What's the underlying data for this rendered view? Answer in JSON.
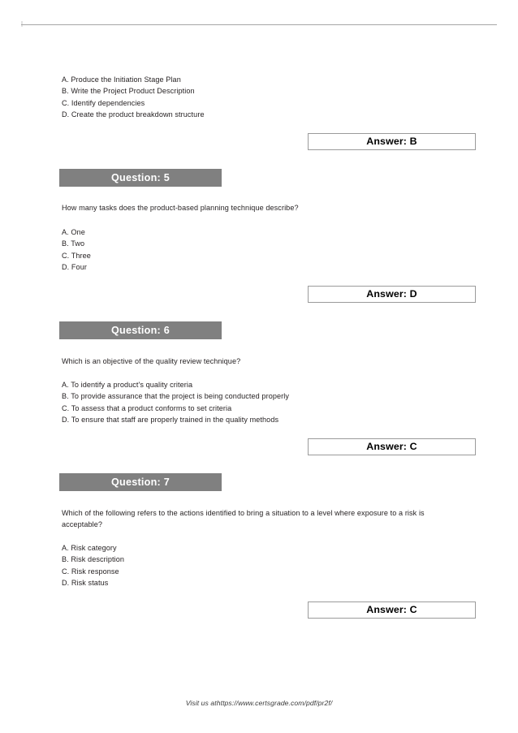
{
  "document": {
    "footer_text": "Visit us athttps://www.certsgrade.com/pdf/pr2f/",
    "accent_gray": "#808080",
    "rule_color": "#a6a6a6",
    "answer_border_color": "#9b9b9b"
  },
  "leading_options": {
    "a": "A. Produce the Initiation Stage Plan",
    "b": "B. Write the Project Product Description",
    "c": "C. Identify dependencies",
    "d": "D. Create the product breakdown structure"
  },
  "leading_answer": {
    "label": "Answer: B"
  },
  "questions": [
    {
      "header": "Question: 5",
      "prompt": "How many tasks does the product-based planning technique describe?",
      "options": {
        "a": "A. One",
        "b": "B. Two",
        "c": "C. Three",
        "d": "D. Four"
      },
      "answer": "Answer: D"
    },
    {
      "header": "Question: 6",
      "prompt": "Which is an objective of the quality review technique?",
      "options": {
        "a": "A. To identify a product's quality criteria",
        "b": "B. To provide assurance that the project is being conducted properly",
        "c": "C. To assess that a product conforms to set criteria",
        "d": "D. To ensure that staff are properly trained in the quality methods"
      },
      "answer": "Answer: C"
    },
    {
      "header": "Question: 7",
      "prompt": "Which of the following refers to the actions identified to bring a situation to a level where exposure to a risk is acceptable?",
      "options": {
        "a": "A. Risk category",
        "b": "B. Risk description",
        "c": "C. Risk response",
        "d": "D. Risk status"
      },
      "answer": "Answer: C"
    }
  ]
}
